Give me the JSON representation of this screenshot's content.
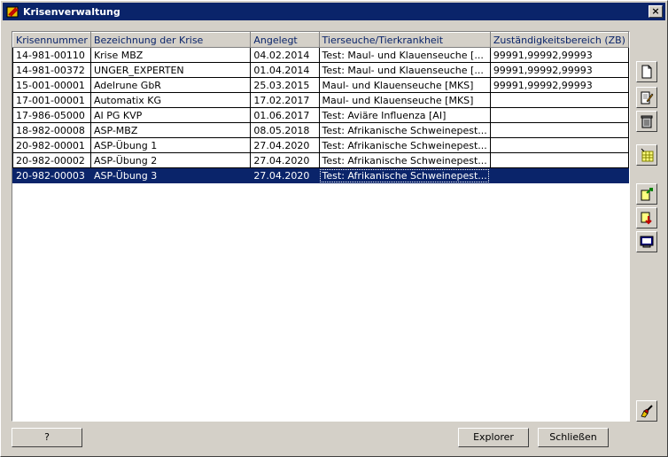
{
  "window": {
    "title": "Krisenverwaltung",
    "close_label": "×"
  },
  "grid": {
    "columns": [
      "Krisennummer",
      "Bezeichnung der Krise",
      "Angelegt",
      "Tierseuche/Tierkrankheit",
      "Zuständigkeitsbereich (ZB)"
    ],
    "rows": [
      [
        "14-981-00110",
        "Krise MBZ",
        "04.02.2014",
        "Test: Maul- und Klauenseuche [...",
        "99991,99992,99993"
      ],
      [
        "14-981-00372",
        "UNGER_EXPERTEN",
        "01.04.2014",
        "Test: Maul- und Klauenseuche [...",
        "99991,99992,99993"
      ],
      [
        "15-001-00001",
        "Adelrune GbR",
        "25.03.2015",
        "Maul- und Klauenseuche [MKS]",
        "99991,99992,99993"
      ],
      [
        "17-001-00001",
        "Automatix KG",
        "17.02.2017",
        "Maul- und Klauenseuche [MKS]",
        ""
      ],
      [
        "17-986-05000",
        "AI PG KVP",
        "01.06.2017",
        "Test: Aviäre Influenza [AI]",
        ""
      ],
      [
        "18-982-00008",
        "ASP-MBZ",
        "08.05.2018",
        "Test: Afrikanische Schweinepest...",
        ""
      ],
      [
        "20-982-00001",
        "ASP-Übung 1",
        "27.04.2020",
        "Test: Afrikanische Schweinepest...",
        ""
      ],
      [
        "20-982-00002",
        "ASP-Übung 2",
        "27.04.2020",
        "Test: Afrikanische Schweinepest...",
        ""
      ],
      [
        "20-982-00003",
        "ASP-Übung 3",
        "27.04.2020",
        "Test: Afrikanische Schweinepest...",
        ""
      ]
    ],
    "selected_row": 8
  },
  "buttons": {
    "help": "?",
    "explorer": "Explorer",
    "close": "Schließen"
  },
  "toolbar_icons": [
    "new-document-icon",
    "edit-icon",
    "delete-icon",
    "grid-select-icon",
    "export-icon",
    "import-icon",
    "monitor-icon",
    "brush-icon"
  ],
  "colors": {
    "selection": "#0a246a",
    "header_text": "#0a246a",
    "face": "#d4d0c8"
  }
}
